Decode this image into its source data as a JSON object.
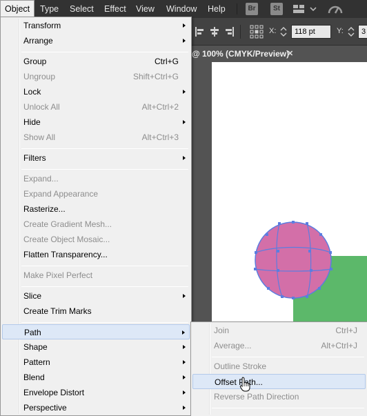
{
  "menubar": {
    "items": [
      "Object",
      "Type",
      "Select",
      "Effect",
      "View",
      "Window",
      "Help"
    ],
    "app_icons": [
      "Br",
      "St"
    ]
  },
  "control_bar": {
    "x_label": "X:",
    "x_value": "118 pt",
    "y_label": "Y:",
    "y_value": "3"
  },
  "document_tab": {
    "title": "@ 100% (CMYK/Preview)",
    "close_glyph": "✕"
  },
  "object_menu": {
    "items": [
      {
        "label": "Transform",
        "shortcut": "",
        "submenu": true,
        "enabled": true
      },
      {
        "label": "Arrange",
        "shortcut": "",
        "submenu": true,
        "enabled": true
      },
      {
        "label": "Group",
        "shortcut": "Ctrl+G",
        "submenu": false,
        "enabled": true
      },
      {
        "label": "Ungroup",
        "shortcut": "Shift+Ctrl+G",
        "submenu": false,
        "enabled": false
      },
      {
        "label": "Lock",
        "shortcut": "",
        "submenu": true,
        "enabled": true
      },
      {
        "label": "Unlock All",
        "shortcut": "Alt+Ctrl+2",
        "submenu": false,
        "enabled": false
      },
      {
        "label": "Hide",
        "shortcut": "",
        "submenu": true,
        "enabled": true
      },
      {
        "label": "Show All",
        "shortcut": "Alt+Ctrl+3",
        "submenu": false,
        "enabled": false
      },
      {
        "label": "Filters",
        "shortcut": "",
        "submenu": true,
        "enabled": true
      },
      {
        "label": "Expand...",
        "shortcut": "",
        "submenu": false,
        "enabled": false
      },
      {
        "label": "Expand Appearance",
        "shortcut": "",
        "submenu": false,
        "enabled": false
      },
      {
        "label": "Rasterize...",
        "shortcut": "",
        "submenu": false,
        "enabled": true
      },
      {
        "label": "Create Gradient Mesh...",
        "shortcut": "",
        "submenu": false,
        "enabled": false
      },
      {
        "label": "Create Object Mosaic...",
        "shortcut": "",
        "submenu": false,
        "enabled": false
      },
      {
        "label": "Flatten Transparency...",
        "shortcut": "",
        "submenu": false,
        "enabled": true
      },
      {
        "label": "Make Pixel Perfect",
        "shortcut": "",
        "submenu": false,
        "enabled": false
      },
      {
        "label": "Slice",
        "shortcut": "",
        "submenu": true,
        "enabled": true
      },
      {
        "label": "Create Trim Marks",
        "shortcut": "",
        "submenu": false,
        "enabled": true
      },
      {
        "label": "Path",
        "shortcut": "",
        "submenu": true,
        "enabled": true,
        "highlighted": true
      },
      {
        "label": "Shape",
        "shortcut": "",
        "submenu": true,
        "enabled": true
      },
      {
        "label": "Pattern",
        "shortcut": "",
        "submenu": true,
        "enabled": true
      },
      {
        "label": "Blend",
        "shortcut": "",
        "submenu": true,
        "enabled": true
      },
      {
        "label": "Envelope Distort",
        "shortcut": "",
        "submenu": true,
        "enabled": true
      },
      {
        "label": "Perspective",
        "shortcut": "",
        "submenu": true,
        "enabled": true
      }
    ]
  },
  "path_submenu": {
    "items": [
      {
        "label": "Join",
        "shortcut": "Ctrl+J",
        "enabled": false
      },
      {
        "label": "Average...",
        "shortcut": "Alt+Ctrl+J",
        "enabled": false
      },
      {
        "label": "Outline Stroke",
        "shortcut": "",
        "enabled": false
      },
      {
        "label": "Offset Path...",
        "shortcut": "",
        "enabled": true,
        "highlighted": true
      },
      {
        "label": "Reverse Path Direction",
        "shortcut": "",
        "enabled": false
      }
    ]
  },
  "colors": {
    "circle_fill": "#d36fa8",
    "mesh_stroke": "#5b7de0",
    "rect_fill": "#5cb86a",
    "menu_bg": "#f0f0f0",
    "highlight_bg": "#dde8f7"
  }
}
